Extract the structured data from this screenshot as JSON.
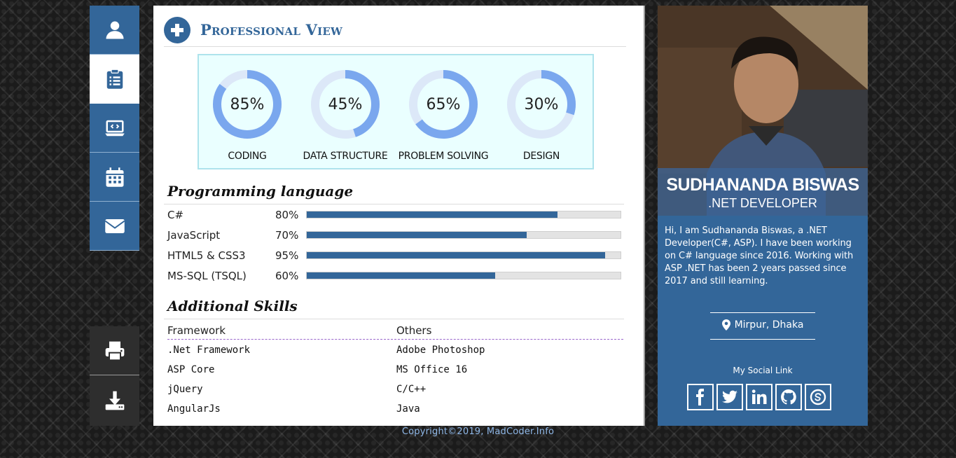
{
  "nav": {
    "items": [
      {
        "icon": "user-icon",
        "active": false
      },
      {
        "icon": "clipboard-icon",
        "active": true
      },
      {
        "icon": "laptop-code-icon",
        "active": false
      },
      {
        "icon": "calendar-icon",
        "active": false
      },
      {
        "icon": "envelope-icon",
        "active": false
      }
    ],
    "tools": [
      {
        "icon": "print-icon"
      },
      {
        "icon": "download-icon"
      }
    ]
  },
  "header": {
    "title": "Professional View"
  },
  "skills": [
    {
      "label": "CODING",
      "percent": 85,
      "display": "85%"
    },
    {
      "label": "DATA STRUCTURE",
      "percent": 45,
      "display": "45%"
    },
    {
      "label": "PROBLEM SOLVING",
      "percent": 65,
      "display": "65%"
    },
    {
      "label": "DESIGN",
      "percent": 30,
      "display": "30%"
    }
  ],
  "programming": {
    "title": "Programming language",
    "items": [
      {
        "name": "C#",
        "percent": 80,
        "display": "80%"
      },
      {
        "name": "JavaScript",
        "percent": 70,
        "display": "70%"
      },
      {
        "name": "HTML5 & CSS3",
        "percent": 95,
        "display": "95%"
      },
      {
        "name": "MS-SQL (TSQL)",
        "percent": 60,
        "display": "60%"
      }
    ]
  },
  "additional": {
    "title": "Additional Skills",
    "headers": [
      "Framework",
      "Others"
    ],
    "rows": [
      [
        ".Net Framework",
        "Adobe Photoshop"
      ],
      [
        "ASP Core",
        "MS Office 16"
      ],
      [
        "jQuery",
        "C/C++"
      ],
      [
        "AngularJs",
        "Java"
      ]
    ]
  },
  "profile": {
    "name": "SUDHANANDA BISWAS",
    "role": ".NET DEVELOPER",
    "bio": "Hi, I am Sudhananda Biswas, a .NET Developer(C#, ASP). I have been working on C# language since 2016. Working with ASP .NET has been 2 years passed since 2017 and still learning.",
    "location": "Mirpur, Dhaka",
    "social_title": "My Social Link",
    "social": [
      "facebook-icon",
      "twitter-icon",
      "linkedin-icon",
      "github-icon",
      "skype-icon"
    ]
  },
  "footer": {
    "text": "Copyright©2019, MadCoder.Info"
  },
  "colors": {
    "primary": "#336699",
    "donut_track": "#dce8f8",
    "donut_fill": "#7aa7ee",
    "skill_box_bg": "#eaffff"
  }
}
